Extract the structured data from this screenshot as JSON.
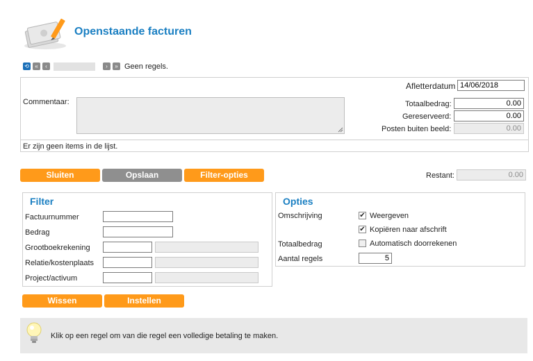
{
  "page": {
    "title": "Openstaande facturen"
  },
  "nav": {
    "status": "Geen regels."
  },
  "summary": {
    "afletterdatum_label": "Afletterdatum",
    "afletterdatum_value": "14/06/2018",
    "commentaar_label": "Commentaar:",
    "totaalbedrag_label": "Totaalbedrag:",
    "totaalbedrag_value": "0.00",
    "gereserveerd_label": "Gereserveerd:",
    "gereserveerd_value": "0.00",
    "posten_label": "Posten buiten beeld:",
    "posten_value": "0.00",
    "empty_message": "Er zijn geen items in de lijst."
  },
  "actions": {
    "sluiten": "Sluiten",
    "opslaan": "Opslaan",
    "filter_opties": "Filter-opties",
    "restant_label": "Restant:",
    "restant_value": "0.00"
  },
  "filter": {
    "title": "Filter",
    "fields": [
      {
        "label": "Factuurnummer"
      },
      {
        "label": "Bedrag"
      },
      {
        "label": "Grootboekrekening"
      },
      {
        "label": "Relatie/kostenplaats"
      },
      {
        "label": "Project/activum"
      }
    ],
    "wissen": "Wissen",
    "instellen": "Instellen"
  },
  "opties": {
    "title": "Opties",
    "omschrijving_label": "Omschrijving",
    "weergeven_label": "Weergeven",
    "weergeven_checked": true,
    "kopieren_label": "Kopiëren naar afschrift",
    "kopieren_checked": true,
    "totaalbedrag_label": "Totaalbedrag",
    "automatisch_label": "Automatisch doorrekenen",
    "automatisch_checked": false,
    "aantal_label": "Aantal regels",
    "aantal_value": "5"
  },
  "hint": {
    "text": "Klik op een regel om van die regel een volledige betaling te maken."
  },
  "icons": {
    "logo": "invoice-pencil-icon",
    "nav_refresh": "refresh-icon",
    "nav_first": "first-page-icon",
    "nav_prev": "prev-page-icon",
    "nav_next": "next-page-icon",
    "nav_last": "last-page-icon",
    "hint": "lightbulb-icon"
  },
  "colors": {
    "accent": "#1a7fc2",
    "button_orange": "#ff9a1a",
    "button_grey": "#8f8f8f"
  }
}
